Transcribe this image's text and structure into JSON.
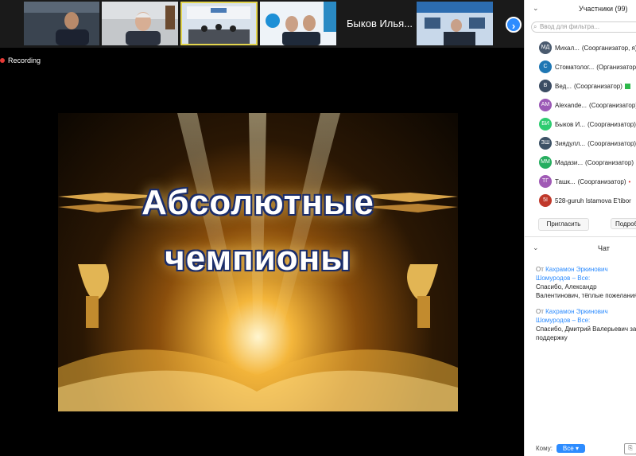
{
  "thumbnails": {
    "name_tile": "Быков Илья...",
    "next_icon": "chevron-right-icon"
  },
  "recording": {
    "label": "Recording",
    "color": "#e53935"
  },
  "shared_screen": {
    "line1": "Абсолютные",
    "line2": "чемпионы"
  },
  "participants": {
    "title": "Участники (99)",
    "search_placeholder": "Ввод для фильтра...",
    "items": [
      {
        "initials": "МД",
        "name": "Михал...",
        "role": "(Соорганизатор, я)",
        "color": "#4a5a6e"
      },
      {
        "initials": "С",
        "name": "Стоматолог...",
        "role": "(Организатор)",
        "color": "#1f77b4"
      },
      {
        "initials": "В",
        "name": "Вед...",
        "role": "(Соорганизатор)",
        "color": "#3b4c63"
      },
      {
        "initials": "AM",
        "name": "Alexande...",
        "role": "(Соорганизатор)",
        "color": "#9b59b6"
      },
      {
        "initials": "БИ",
        "name": "Быков И...",
        "role": "(Соорганизатор)",
        "color": "#2ecc71"
      },
      {
        "initials": "ЗШ",
        "name": "Зиядулл...",
        "role": "(Соорганизатор)",
        "color": "#3d5266"
      },
      {
        "initials": "ММ",
        "name": "Мадази...",
        "role": "(Соорганизатор)",
        "color": "#27ae60"
      },
      {
        "initials": "ТГ",
        "name": "Ташк...",
        "role": "(Соорганизатор)",
        "color": "#a05ab5"
      },
      {
        "initials": "5I",
        "name": "528-guruh Istamova E'tibor",
        "role": "",
        "color": "#c0392b"
      }
    ],
    "invite_label": "Пригласить",
    "more_label": "Подроб"
  },
  "chat": {
    "title": "Чат",
    "from_label": "От",
    "messages": [
      {
        "sender": "Кахрамон Эркинович Шомуродов – Все:",
        "text": "Спасибо, Александр Валентинович, тёплые пожелания"
      },
      {
        "sender": "Кахрамон Эркинович Шомуродов – Все:",
        "text": "Спасибо, Дмитрий Валерьевич за поддержку"
      }
    ],
    "to_label": "Кому:",
    "to_value": "Все"
  },
  "colors": {
    "accent": "#2d8cff",
    "active_border": "#e3d54f"
  }
}
